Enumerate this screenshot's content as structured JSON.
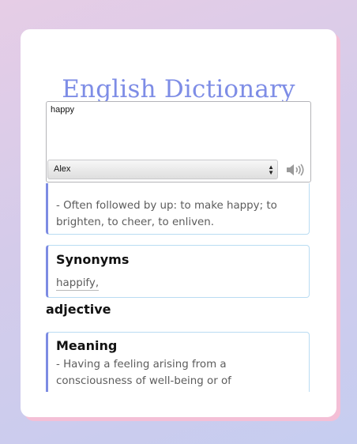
{
  "app": {
    "title": "English Dictionary"
  },
  "search": {
    "value": "happy",
    "voice_selected": "Alex"
  },
  "results": {
    "verb_meaning_lines": [
      "- Often followed by up: to make happy; to",
      "brighten, to cheer, to enliven."
    ],
    "synonyms_heading": "Synonyms",
    "synonyms": [
      "happify,"
    ],
    "part_of_speech": "adjective",
    "meaning_heading": "Meaning",
    "adjective_meaning_lines": [
      "- Having a feeling arising from a",
      "consciousness of well-being or of"
    ]
  },
  "colors": {
    "accent": "#7e8de6",
    "card_shadow": "#f4bfd6",
    "box_border": "#b9dcf2"
  },
  "icons": {
    "speaker": "speaker-volume-icon",
    "select_arrow": "updown-arrows-icon"
  }
}
